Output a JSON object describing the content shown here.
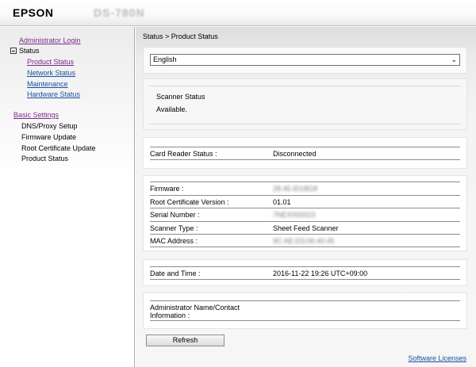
{
  "header": {
    "logo": "EPSON",
    "model": "DS-780N"
  },
  "sidebar": {
    "admin_login": "Administrator Login",
    "status": "Status",
    "status_items": [
      "Product Status",
      "Network Status",
      "Maintenance",
      "Hardware Status"
    ],
    "basic_settings": "Basic Settings",
    "basic_items": [
      "DNS/Proxy Setup",
      "Firmware Update",
      "Root Certificate Update",
      "Product Status"
    ]
  },
  "main": {
    "breadcrumb": "Status > Product Status",
    "language": {
      "selected": "English"
    },
    "scanner_status": {
      "title": "Scanner Status",
      "value": "Available."
    },
    "card_reader": {
      "label": "Card Reader Status :",
      "value": "Disconnected"
    },
    "info": [
      {
        "label": "Firmware :",
        "value": "28.45.ID18G8"
      },
      {
        "label": "Root Certificate Version :",
        "value": "01.01"
      },
      {
        "label": "Serial Number :",
        "value": "7NEX000023"
      },
      {
        "label": "Scanner Type :",
        "value": "Sheet Feed Scanner"
      },
      {
        "label": "MAC Address :",
        "value": "9C:AE:D3:06:40:45"
      }
    ],
    "datetime": {
      "label": "Date and Time :",
      "value": "2016-11-22 19:26 UTC+09:00"
    },
    "admin_contact": {
      "label": "Administrator Name/Contact Information :",
      "value": ""
    },
    "refresh_label": "Refresh",
    "software_licenses": "Software Licenses"
  },
  "colors": {
    "visited_link": "#7a2a8a",
    "link": "#1a4fa0",
    "divider": "#8c8c8c"
  }
}
